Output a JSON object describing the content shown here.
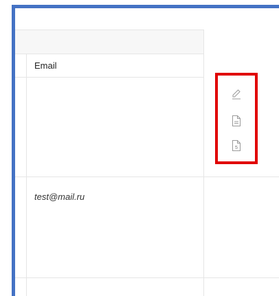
{
  "table": {
    "columns": [
      "Email"
    ],
    "rows": [
      {
        "email": ""
      },
      {
        "email": "test@mail.ru"
      }
    ]
  },
  "actions": {
    "icons": [
      "pencil-edit-icon",
      "document-icon",
      "document-5-icon"
    ],
    "doc_badge": "5"
  },
  "colors": {
    "frame_border": "#4472c4",
    "highlight": "#e00000",
    "grid_line": "#e5e5e5",
    "header_bg": "#f7f7f7"
  }
}
